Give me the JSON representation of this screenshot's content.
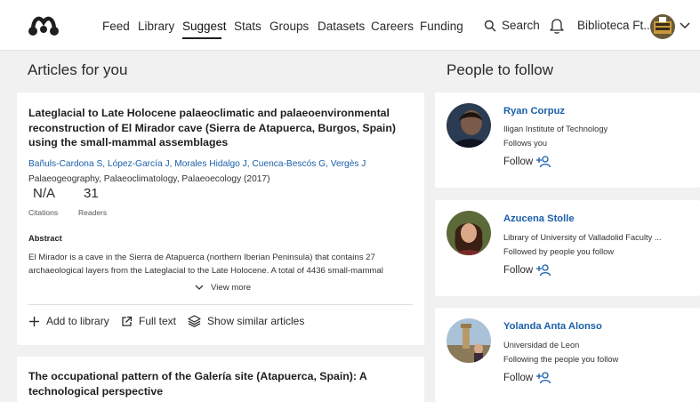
{
  "nav": {
    "items": [
      "Feed",
      "Library",
      "Suggest",
      "Stats",
      "Groups",
      "Datasets",
      "Careers",
      "Funding"
    ],
    "active": "Suggest",
    "search_label": "Search",
    "org_name": "Biblioteca Ft..."
  },
  "articles_heading": "Articles for you",
  "people_heading": "People to follow",
  "article1": {
    "title": "Lateglacial to Late Holocene palaeoclimatic and palaeoenvironmental reconstruction of El Mirador cave (Sierra de Atapuerca, Burgos, Spain) using the small-mammal assemblages",
    "authors": "Bañuls-Cardona S, López-García J, Morales Hidalgo J, Cuenca-Bescós G, Vergès J",
    "journal": "Palaeogeography, Palaeoclimatology, Palaeoecology (2017)",
    "citations_value": "N/A",
    "citations_label": "Citations",
    "readers_value": "31",
    "readers_label": "Readers",
    "abstract_heading": "Abstract",
    "abstract": "El Mirador is a cave in the Sierra de Atapuerca (northern Iberian Peninsula) that contains 27 archaeological layers from the Lateglacial to the Late Holocene. A total of 4436 small-mammal",
    "view_more": "View more",
    "add_to_library": "Add to library",
    "full_text": "Full text",
    "show_similar": "Show similar articles"
  },
  "article2": {
    "title": "The occupational pattern of the Galería site (Atapuerca, Spain): A technological perspective"
  },
  "people": [
    {
      "name": "Ryan Corpuz",
      "line1": "Iligan Institute of Technology",
      "line2": "Follows you",
      "follow": "Follow"
    },
    {
      "name": "Azucena Stolle",
      "line1": "Library of University of Valladolid Faculty ...",
      "line2": "Followed by people you follow",
      "follow": "Follow"
    },
    {
      "name": "Yolanda Anta Alonso",
      "line1": "Universidad de Leon",
      "line2": "Following the people you follow",
      "follow": "Follow"
    }
  ],
  "colors": {
    "link_blue": "#1a5fa8",
    "page_bg": "#f1f1f1",
    "card_bg": "#ffffff"
  }
}
